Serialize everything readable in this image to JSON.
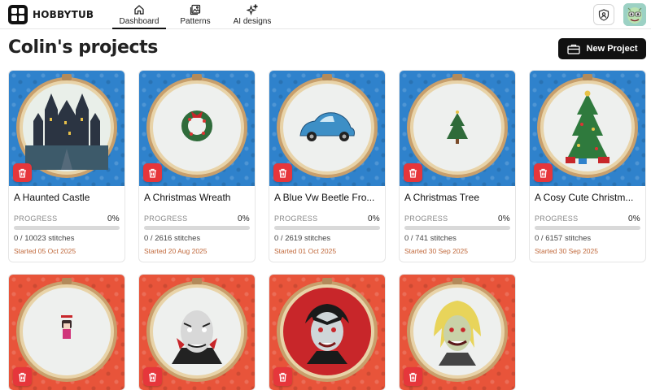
{
  "brand": {
    "name": "HOBBYTUB"
  },
  "nav": [
    {
      "label": "Dashboard",
      "icon": "home-icon",
      "active": true
    },
    {
      "label": "Patterns",
      "icon": "image-gallery-icon",
      "active": false
    },
    {
      "label": "AI designs",
      "icon": "sparkles-icon",
      "active": false
    }
  ],
  "header": {
    "title": "Colin's projects",
    "new_project_label": "New Project"
  },
  "labels": {
    "progress": "PROGRESS"
  },
  "colors": {
    "blue_bg": "#2f82cc",
    "red_bg": "#e8543a",
    "delete": "#e6363b",
    "started_text": "#c0693c"
  },
  "projects": [
    {
      "title": "A Haunted Castle",
      "progress": "0%",
      "progress_value": 0,
      "stitches": "0 / 10023 stitches",
      "started": "Started 05 Oct 2025",
      "theme": "blue",
      "art": "haunted-castle"
    },
    {
      "title": "A Christmas Wreath",
      "progress": "0%",
      "progress_value": 0,
      "stitches": "0 / 2616 stitches",
      "started": "Started 20 Aug 2025",
      "theme": "blue",
      "art": "wreath"
    },
    {
      "title": "A Blue Vw Beetle Fro...",
      "progress": "0%",
      "progress_value": 0,
      "stitches": "0 / 2619 stitches",
      "started": "Started 01 Oct 2025",
      "theme": "blue",
      "art": "beetle"
    },
    {
      "title": "A Christmas Tree",
      "progress": "0%",
      "progress_value": 0,
      "stitches": "0 / 741 stitches",
      "started": "Started 30 Sep 2025",
      "theme": "blue",
      "art": "small-tree"
    },
    {
      "title": "A Cosy Cute Christm...",
      "progress": "0%",
      "progress_value": 0,
      "stitches": "0 / 6157 stitches",
      "started": "Started 30 Sep 2025",
      "theme": "blue",
      "art": "big-tree"
    },
    {
      "title": "",
      "theme": "red",
      "art": "small-figure"
    },
    {
      "title": "",
      "theme": "red",
      "art": "nosferatu"
    },
    {
      "title": "",
      "theme": "red",
      "art": "dracula"
    },
    {
      "title": "",
      "theme": "red",
      "art": "blond-vampire"
    }
  ]
}
